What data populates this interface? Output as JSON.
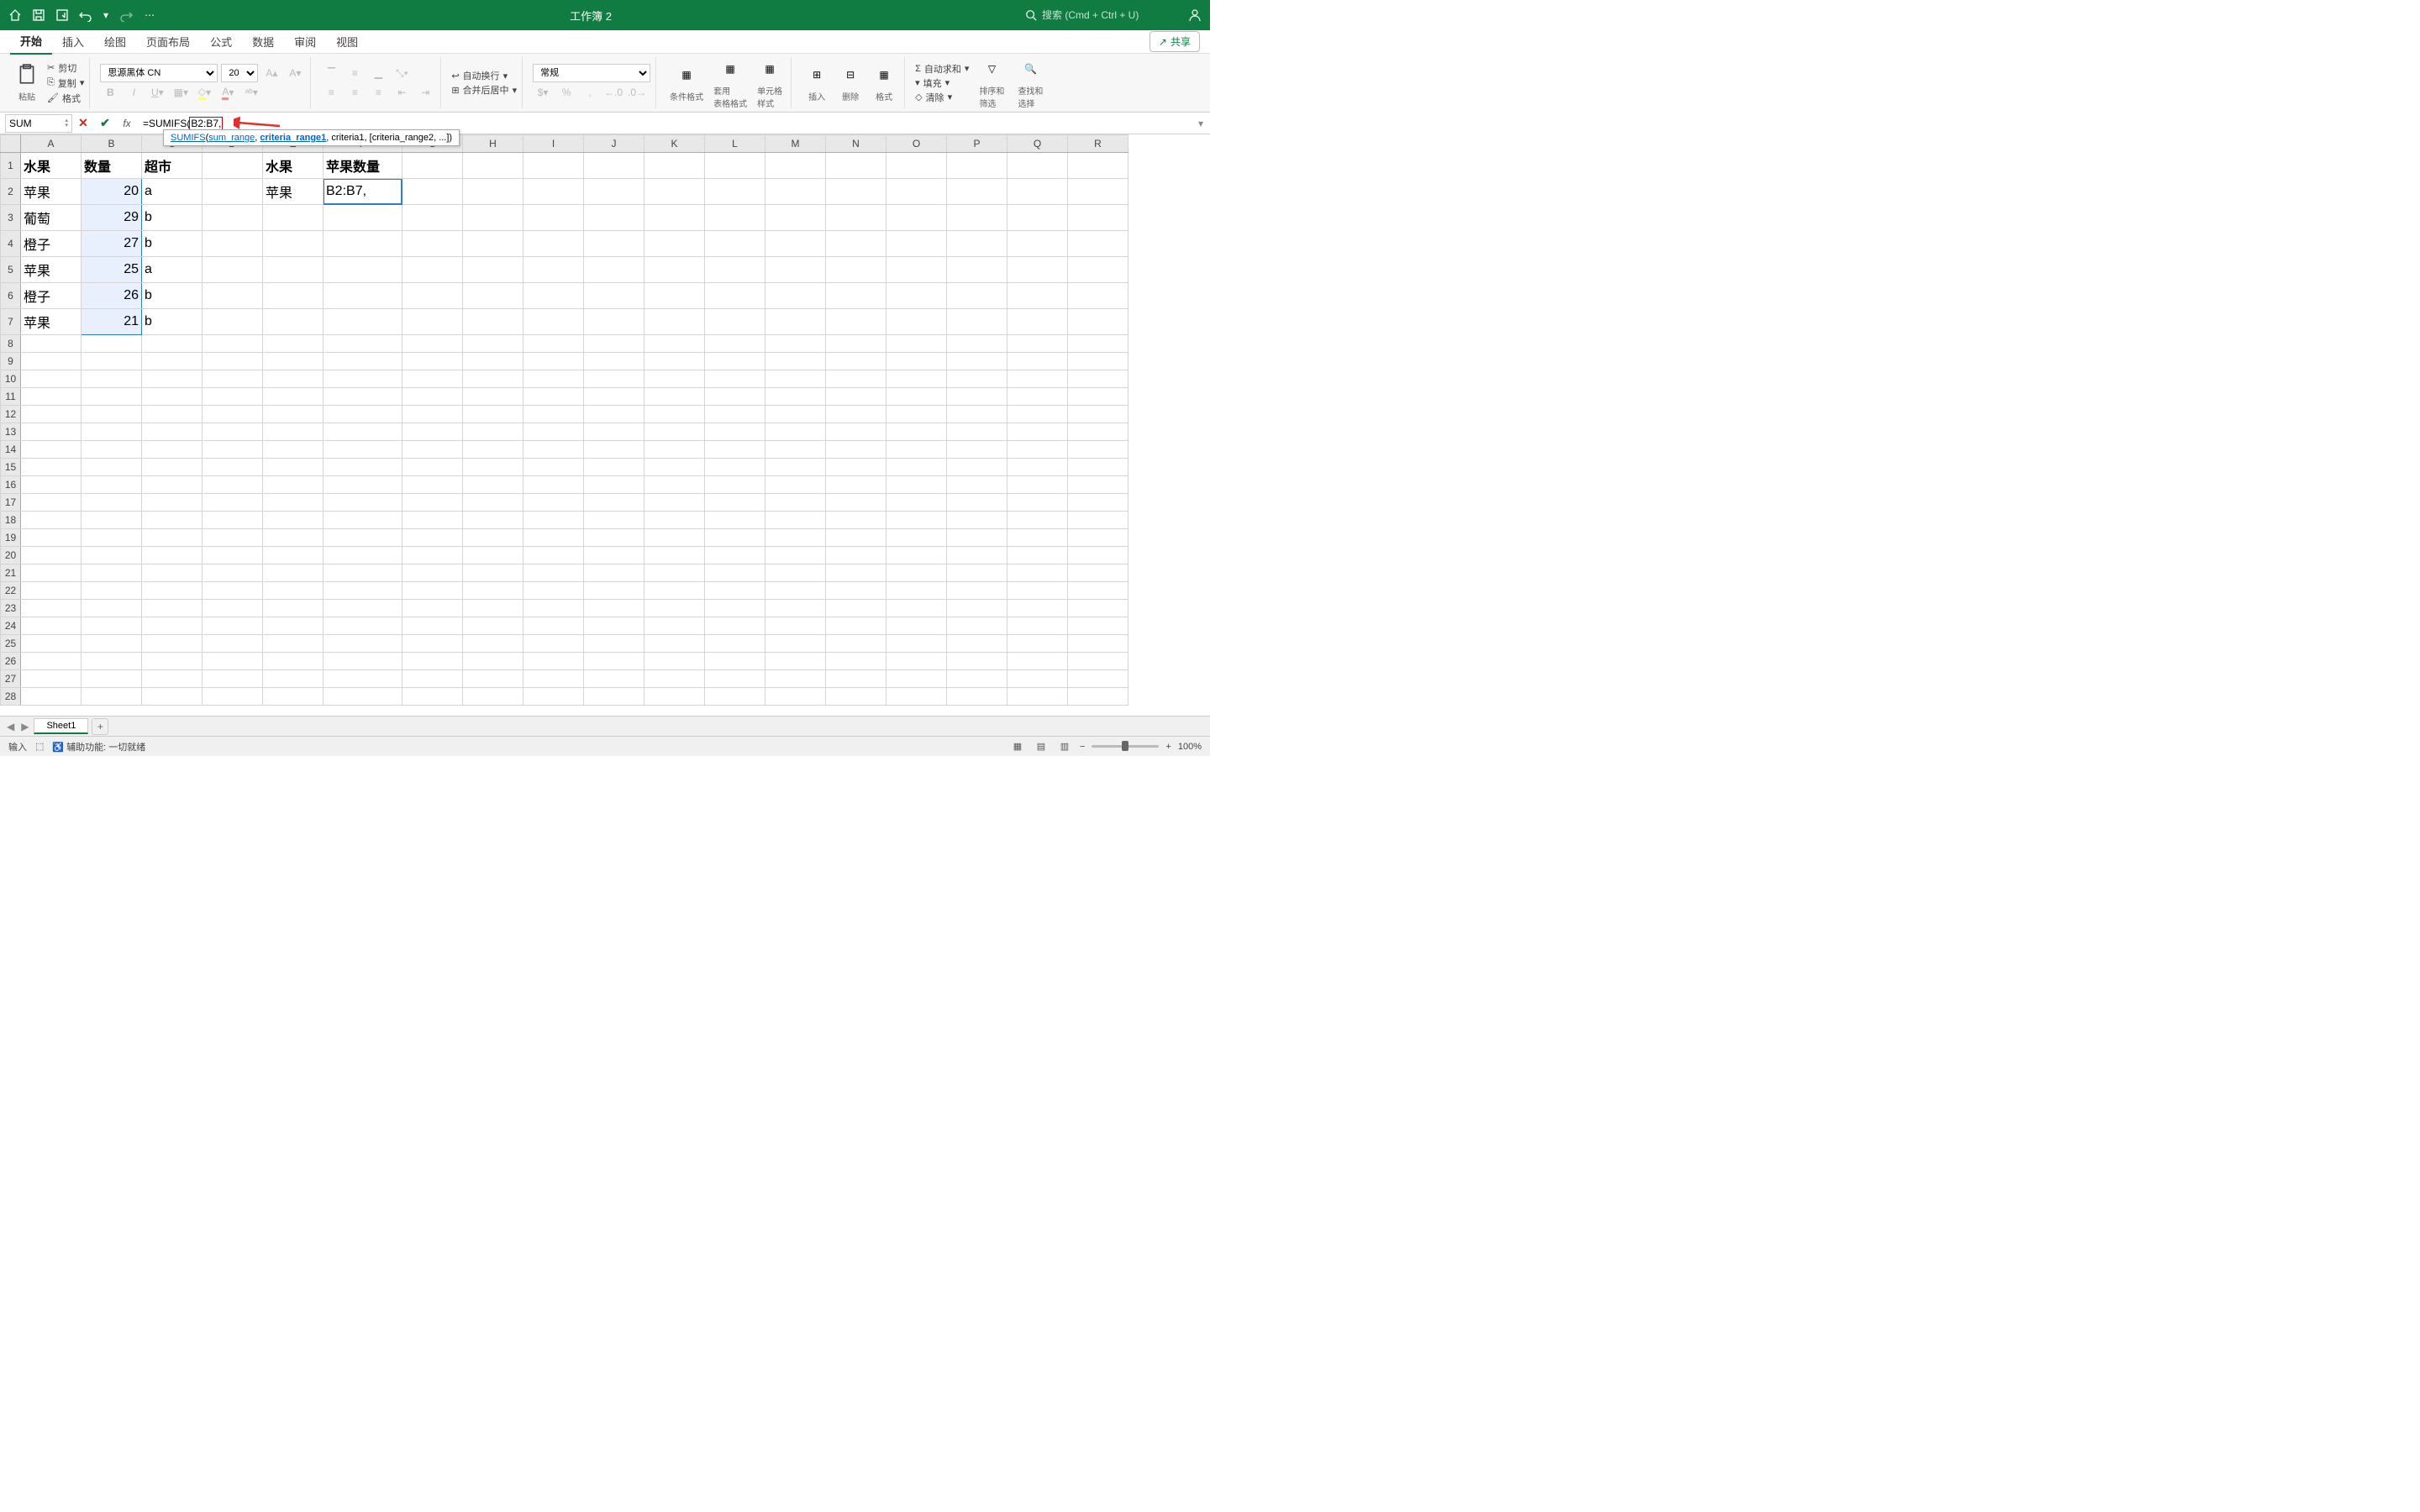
{
  "titlebar": {
    "title": "工作簿 2",
    "search_placeholder": "搜索 (Cmd + Ctrl + U)"
  },
  "ribbon_tabs": [
    "开始",
    "插入",
    "绘图",
    "页面布局",
    "公式",
    "数据",
    "审阅",
    "视图"
  ],
  "share_label": "共享",
  "ribbon": {
    "paste": "粘贴",
    "cut": "剪切",
    "copy": "复制",
    "format": "格式",
    "font_name": "思源黑体 CN",
    "font_size": "20",
    "wrap": "自动换行",
    "merge": "合并后居中",
    "number_format": "常规",
    "cond_format": "条件格式",
    "table_format": "套用\n表格格式",
    "cell_styles": "单元格\n样式",
    "insert": "插入",
    "delete": "删除",
    "format_cells": "格式",
    "autosum": "自动求和",
    "fill": "填充",
    "clear": "清除",
    "sort": "排序和\n筛选",
    "find": "查找和\n选择"
  },
  "name_box": "SUM",
  "formula_prefix": "=SUMIFS(",
  "formula_highlighted": "B2:B7,",
  "tooltip": {
    "fn": "SUMIFS",
    "open": "(",
    "arg1": "sum_range",
    "arg2": "criteria_range1",
    "rest": ", criteria1, [criteria_range2, ...])"
  },
  "columns": [
    "A",
    "B",
    "C",
    "D",
    "E",
    "F",
    "G",
    "H",
    "I",
    "J",
    "K",
    "L",
    "M",
    "N",
    "O",
    "P",
    "Q",
    "R"
  ],
  "sheet": {
    "headers": {
      "A1": "水果",
      "B1": "数量",
      "C1": "超市",
      "E1": "水果",
      "F1": "苹果数量"
    },
    "rows": [
      {
        "a": "苹果",
        "b": "20",
        "c": "a",
        "e": "苹果",
        "f": "B2:B7,"
      },
      {
        "a": "葡萄",
        "b": "29",
        "c": "b"
      },
      {
        "a": "橙子",
        "b": "27",
        "c": "b"
      },
      {
        "a": "苹果",
        "b": "25",
        "c": "a"
      },
      {
        "a": "橙子",
        "b": "26",
        "c": "b"
      },
      {
        "a": "苹果",
        "b": "21",
        "c": "b"
      }
    ]
  },
  "sheet_tab": "Sheet1",
  "status": {
    "mode": "输入",
    "accessibility": "辅助功能: 一切就绪",
    "zoom": "100%"
  }
}
